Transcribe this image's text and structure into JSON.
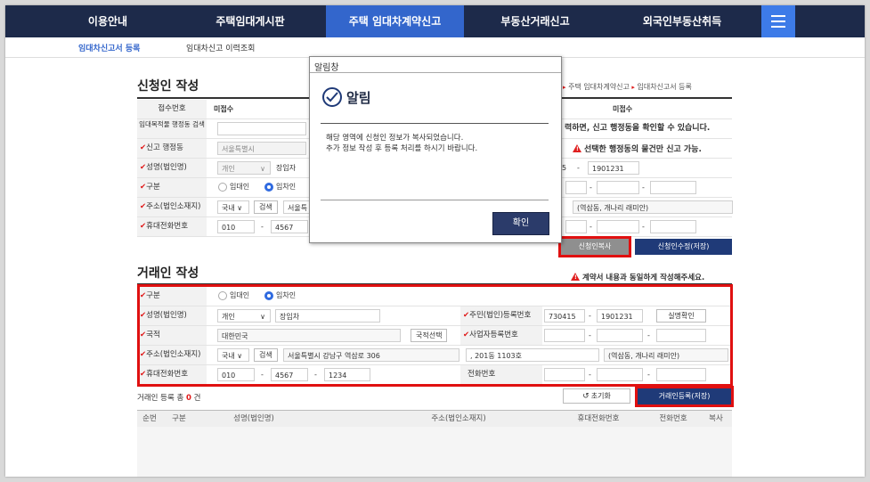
{
  "nav": {
    "items": [
      "이용안내",
      "주택임대게시판",
      "주택 임대차계약신고",
      "부동산거래신고",
      "외국인부동산취득"
    ]
  },
  "subnav": [
    "임대차신고서 등록",
    "임대차신고 이력조회"
  ],
  "breadcrumb": [
    "주택 임대차계약신고",
    "임대차신고서 등록"
  ],
  "applicant": {
    "title": "신청인 작성",
    "receipt_label": "접수번호",
    "receipt_value": "미접수",
    "receipt_value2": "미접수",
    "search_label": "임대목적물 행정동 검색",
    "notice_partial": "력하면, 신고 행정동을 확인할 수 있습니다.",
    "district_label": "신고 행정동",
    "district_value": "서울특별시",
    "district_warning": "선택한 행정동의 물건만 신고 가능.",
    "name_label": "성명(법인명)",
    "person_type": "개인",
    "name_value": "장임자",
    "ssn_front_partial": "5",
    "ssn_back": "1901231",
    "type_label": "구분",
    "radio_lessor": "임대인",
    "radio_lessee": "임차인",
    "addr_label": "주소(법인소재지)",
    "country": "국내",
    "search_btn": "검색",
    "addr_value": "서울특",
    "addr_ref": "(역삼동, 개나리 래미안)",
    "phone_label": "휴대전화번호",
    "phone1": "010",
    "phone2": "4567",
    "copy_btn": "신청인복사",
    "save_btn": "신청인수정(저장)"
  },
  "dialog": {
    "window_title": "알림창",
    "heading": "알림",
    "message1": "해당 영역에 신청인 정보가 복사되었습니다.",
    "message2": "추가 정보 작성 후 등록 처리를 하시기 바랍니다.",
    "ok": "확인"
  },
  "trade": {
    "title": "거래인 작성",
    "warning": "계약서 내용과 동일하게 작성해주세요.",
    "type_label": "구분",
    "radio_lessor": "임대인",
    "radio_lessee": "임차인",
    "name_label": "성명(법인명)",
    "person_type": "개인",
    "name_value": "장임차",
    "ssn_label": "주민(법인)등록번호",
    "ssn_front": "730415",
    "ssn_back": "1901231",
    "verify_btn": "실명확인",
    "nation_label": "국적",
    "nation_value": "대한민국",
    "nation_btn": "국적선택",
    "biz_label": "사업자등록번호",
    "addr_label": "주소(법인소재지)",
    "country": "국내",
    "search_btn": "검색",
    "addr_value": "서울특별시 강남구 역삼로 306",
    "addr_detail": ", 201동 1103호",
    "addr_ref": "(역삼동, 개나리 래미안)",
    "phone_label": "휴대전화번호",
    "phone1": "010",
    "phone2": "4567",
    "phone3": "1234",
    "tel_label": "전화번호",
    "count_prefix": "거래인 등록 총",
    "count_value": "0",
    "count_suffix": "건",
    "reset_btn": "초기화",
    "register_btn": "거래인등록(저장)"
  },
  "table": {
    "headers": [
      "순번",
      "구분",
      "성명(법인명)",
      "주소(법인소재지)",
      "휴대전화번호",
      "전화번호",
      "복사"
    ]
  }
}
